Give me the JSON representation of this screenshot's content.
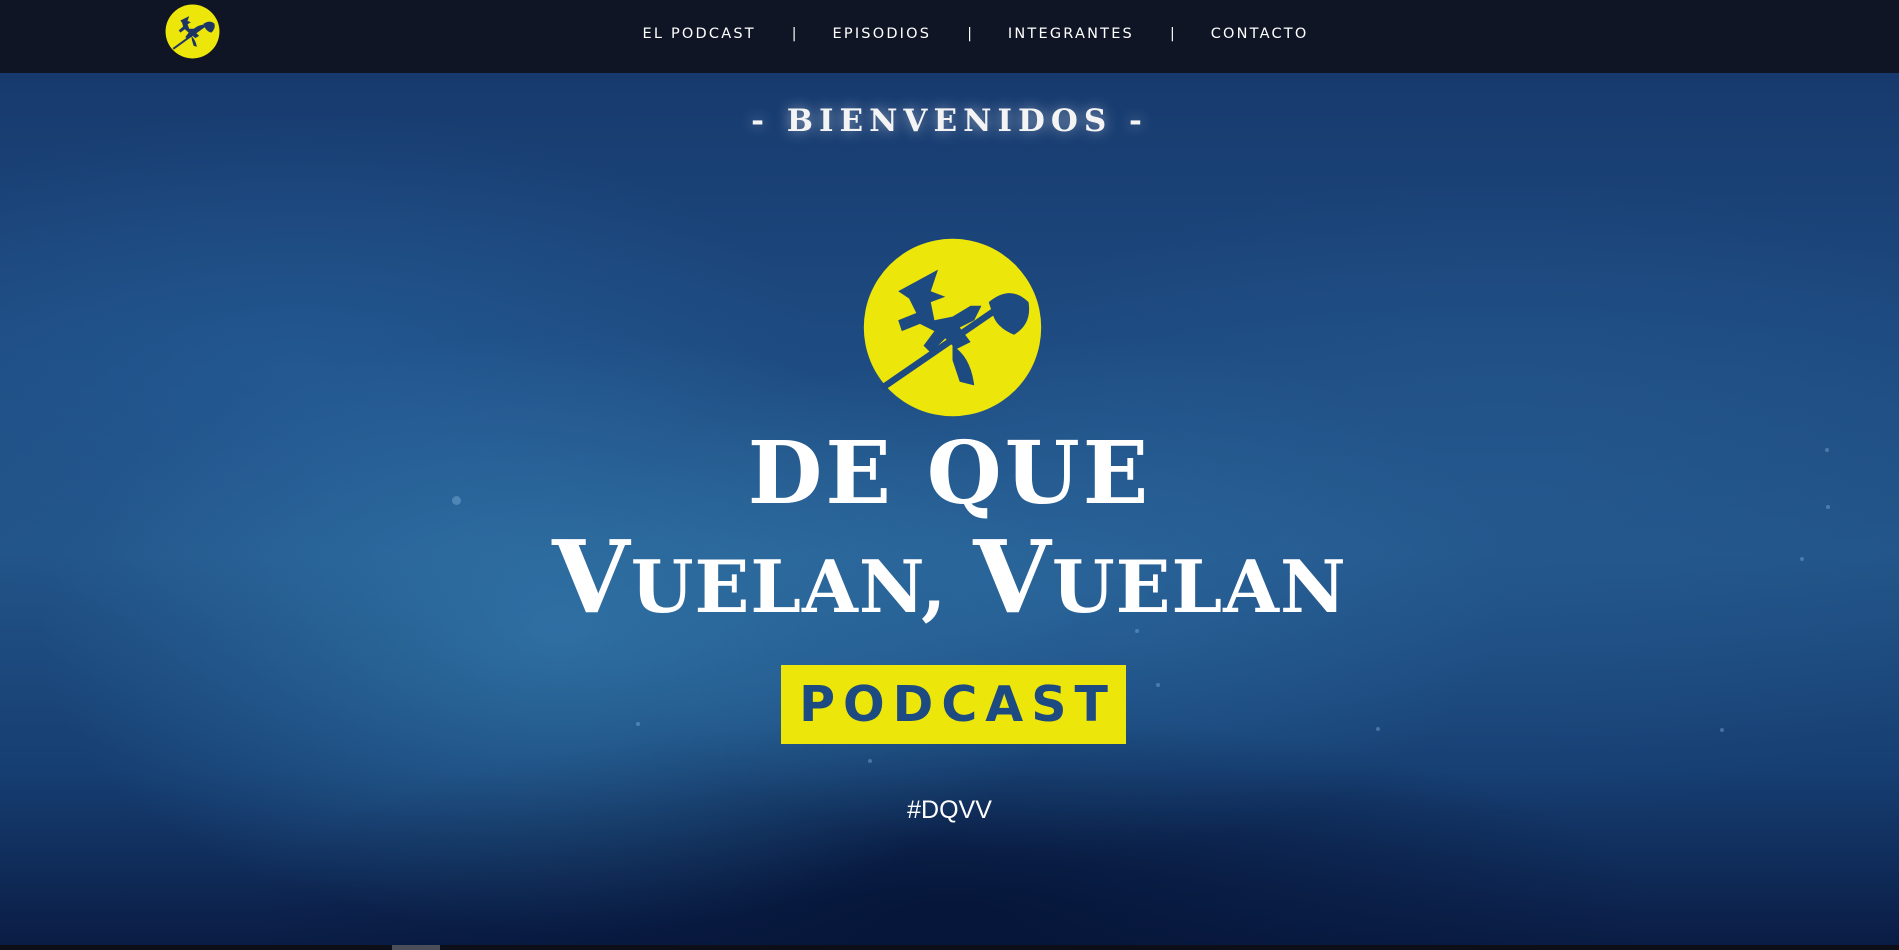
{
  "colors": {
    "nav_bg": "#101525",
    "accent_yellow": "#ece60a",
    "brand_blue": "#1d4a80",
    "text_white": "#ffffff"
  },
  "nav": {
    "logo_icon": "witch-on-broom-moon-icon",
    "items": [
      {
        "label": "EL PODCAST"
      },
      {
        "label": "EPISODIOS"
      },
      {
        "label": "INTEGRANTES"
      },
      {
        "label": "CONTACTO"
      }
    ],
    "separator": "|"
  },
  "hero": {
    "welcome": "- BIENVENIDOS -",
    "logo_icon": "witch-on-broom-moon-icon",
    "title_line1": "DE QUE",
    "title_line2_parts": [
      {
        "text": "V",
        "big": true
      },
      {
        "text": "UELAN, ",
        "big": false
      },
      {
        "text": "V",
        "big": true
      },
      {
        "text": "UELAN",
        "big": false
      }
    ],
    "badge": "PODCAST",
    "hashtag": "#DQVV"
  }
}
